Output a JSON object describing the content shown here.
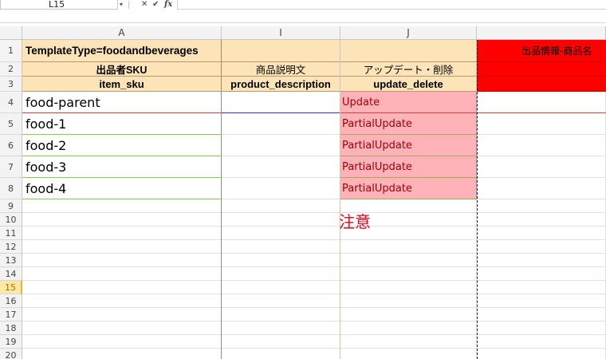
{
  "formula_bar": {
    "name_box": "L15",
    "name_box_dropdown": "▾",
    "cancel_symbol": "✕",
    "enter_symbol": "✔",
    "function_symbol": "fx",
    "formula": ""
  },
  "columns": [
    "A",
    "I",
    "J"
  ],
  "rows": [
    "1",
    "2",
    "3",
    "4",
    "5",
    "6",
    "7",
    "8",
    "9",
    "10",
    "11",
    "12",
    "13",
    "14",
    "15",
    "16",
    "17",
    "18",
    "19",
    "20"
  ],
  "active_row": "15",
  "header_rows": {
    "template_type": "TemplateType=foodandbeverages",
    "red_banner": "出品情報-商品名",
    "labels_jp": [
      "出品者SKU",
      "商品説明文",
      "アップデート・削除"
    ],
    "labels_en": [
      "item_sku",
      "product_description",
      "update_delete"
    ]
  },
  "data_rows": [
    {
      "sku": "food-parent",
      "description": "",
      "update": "Update"
    },
    {
      "sku": "food-1",
      "description": "",
      "update": "PartialUpdate"
    },
    {
      "sku": "food-2",
      "description": "",
      "update": "PartialUpdate"
    },
    {
      "sku": "food-3",
      "description": "",
      "update": "PartialUpdate"
    },
    {
      "sku": "food-4",
      "description": "",
      "update": "PartialUpdate"
    }
  ],
  "note": "注意",
  "colors": {
    "header_fill": "#fce4b8",
    "banner_red": "#ff0000",
    "update_fill": "#ffb3b9",
    "update_text": "#9c0006",
    "note_red": "#e8001c",
    "row_line_green": "#7fd24a",
    "row_line_red": "#d84040",
    "row_line_blue": "#3030e0"
  }
}
